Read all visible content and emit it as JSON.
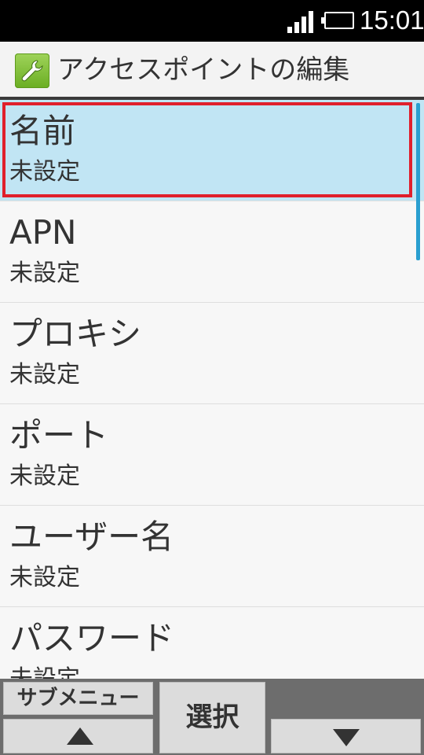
{
  "status_bar": {
    "time": "15:01",
    "signal_icon": "signal-bars-icon",
    "battery_icon": "battery-icon"
  },
  "header": {
    "icon": "wrench-icon",
    "title": "アクセスポイントの編集"
  },
  "list": {
    "items": [
      {
        "title": "名前",
        "value": "未設定",
        "selected": true
      },
      {
        "title": "APN",
        "value": "未設定"
      },
      {
        "title": "プロキシ",
        "value": "未設定"
      },
      {
        "title": "ポート",
        "value": "未設定"
      },
      {
        "title": "ユーザー名",
        "value": "未設定"
      },
      {
        "title": "パスワード",
        "value": "未設定"
      }
    ]
  },
  "softkeys": {
    "submenu_label": "サブメニュー",
    "select_label": "選択",
    "up_icon": "up-arrow-icon",
    "down_icon": "down-arrow-icon"
  },
  "colors": {
    "selected_bg": "#c1e5f4",
    "focus_border": "#e0202c",
    "scrollbar": "#2a9fd0"
  }
}
